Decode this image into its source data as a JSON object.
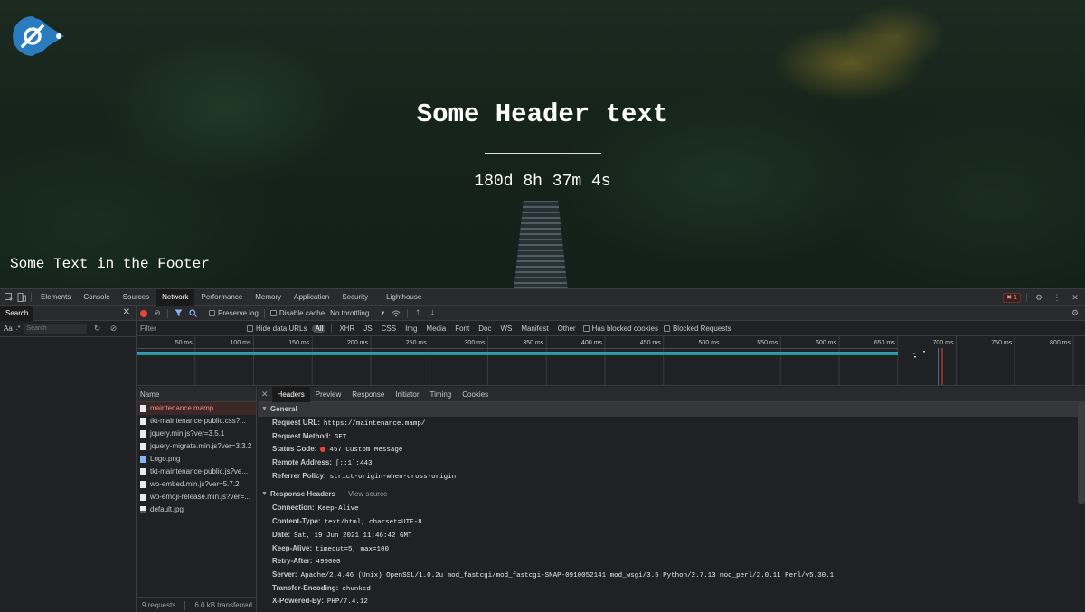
{
  "page": {
    "header_text": "Some Header text",
    "countdown": "180d 8h 37m 4s",
    "footer_text": "Some Text in the Footer"
  },
  "devtools": {
    "tabs": [
      "Elements",
      "Console",
      "Sources",
      "Network",
      "Performance",
      "Memory",
      "Application",
      "Security",
      "Lighthouse"
    ],
    "active_tab": "Network",
    "error_count": "1",
    "search": {
      "tab_label": "Search",
      "aa_label": "Aa",
      "regex_label": ".*",
      "placeholder": "Search"
    },
    "toolbar": {
      "preserve_log": "Preserve log",
      "disable_cache": "Disable cache",
      "throttling": "No throttling"
    },
    "filter": {
      "placeholder": "Filter",
      "hide_data_urls": "Hide data URLs",
      "types": [
        "All",
        "XHR",
        "JS",
        "CSS",
        "Img",
        "Media",
        "Font",
        "Doc",
        "WS",
        "Manifest",
        "Other"
      ],
      "has_blocked_cookies": "Has blocked cookies",
      "blocked_requests": "Blocked Requests"
    },
    "timeline": {
      "ticks": [
        "50 ms",
        "100 ms",
        "150 ms",
        "200 ms",
        "250 ms",
        "300 ms",
        "350 ms",
        "400 ms",
        "450 ms",
        "500 ms",
        "550 ms",
        "600 ms",
        "650 ms",
        "700 ms",
        "750 ms",
        "800 ms"
      ]
    },
    "requests": {
      "header": "Name",
      "items": [
        {
          "name": "maintenance.mamp",
          "icon": "document-icon",
          "selected": true
        },
        {
          "name": "tkt-maintenance-public.css?...",
          "icon": "document-icon"
        },
        {
          "name": "jquery.min.js?ver=3.5.1",
          "icon": "document-icon"
        },
        {
          "name": "jquery-migrate.min.js?ver=3.3.2",
          "icon": "document-icon"
        },
        {
          "name": "Logo.png",
          "icon": "image-icon"
        },
        {
          "name": "tkt-maintenance-public.js?ve...",
          "icon": "document-icon"
        },
        {
          "name": "wp-embed.min.js?ver=5.7.2",
          "icon": "document-icon"
        },
        {
          "name": "wp-emoji-release.min.js?ver=...",
          "icon": "document-icon"
        },
        {
          "name": "default.jpg",
          "icon": "image-dark-icon"
        }
      ],
      "summary_requests": "9 requests",
      "summary_transferred": "6.0 kB transferred"
    },
    "details": {
      "tabs": [
        "Headers",
        "Preview",
        "Response",
        "Initiator",
        "Timing",
        "Cookies"
      ],
      "active_tab": "Headers",
      "general_title": "General",
      "general": [
        {
          "key": "Request URL:",
          "value": "https://maintenance.mamp/"
        },
        {
          "key": "Request Method:",
          "value": "GET"
        },
        {
          "key": "Status Code:",
          "value": "457 Custom Message",
          "status_dot": "#e2463d"
        },
        {
          "key": "Remote Address:",
          "value": "[::1]:443"
        },
        {
          "key": "Referrer Policy:",
          "value": "strict-origin-when-cross-origin"
        }
      ],
      "response_title": "Response Headers",
      "view_source": "View source",
      "response_headers": [
        {
          "key": "Connection:",
          "value": "Keep-Alive"
        },
        {
          "key": "Content-Type:",
          "value": "text/html; charset=UTF-8"
        },
        {
          "key": "Date:",
          "value": "Sat, 19 Jun 2021 11:46:42 GMT"
        },
        {
          "key": "Keep-Alive:",
          "value": "timeout=5, max=100"
        },
        {
          "key": "Retry-After:",
          "value": "490000"
        },
        {
          "key": "Server:",
          "value": "Apache/2.4.46 (Unix) OpenSSL/1.0.2u mod_fastcgi/mod_fastcgi-SNAP-0910052141 mod_wsgi/3.5 Python/2.7.13 mod_perl/2.0.11 Perl/v5.30.1"
        },
        {
          "key": "Transfer-Encoding:",
          "value": "chunked"
        },
        {
          "key": "X-Powered-By:",
          "value": "PHP/7.4.12"
        }
      ]
    }
  }
}
